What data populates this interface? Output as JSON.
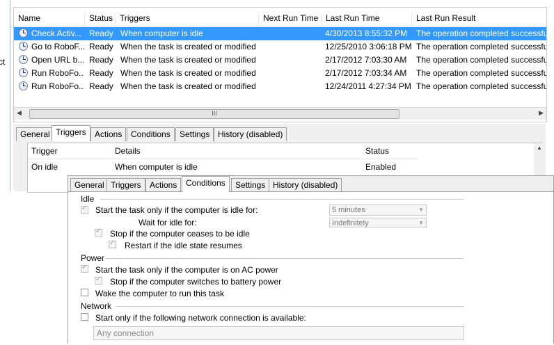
{
  "left_fragment": {
    "text": "ct"
  },
  "task_list": {
    "columns": [
      "Name",
      "Status",
      "Triggers",
      "Next Run Time",
      "Last Run Time",
      "Last Run Result"
    ],
    "rows": [
      {
        "name": "Check Activ...",
        "status": "Ready",
        "triggers": "When computer is idle",
        "next_run": "",
        "last_run": "4/30/2013 8:55:32 PM",
        "result": "The operation completed successfu",
        "selected": true
      },
      {
        "name": "Go to RoboF...",
        "status": "Ready",
        "triggers": "When the task is created or modified",
        "next_run": "",
        "last_run": "12/25/2010 3:06:18 PM",
        "result": "The operation completed successfu",
        "selected": false
      },
      {
        "name": "Open URL b...",
        "status": "Ready",
        "triggers": "When the task is created or modified",
        "next_run": "",
        "last_run": "2/17/2012 7:03:30 AM",
        "result": "The operation completed successfu",
        "selected": false
      },
      {
        "name": "Run RoboFo...",
        "status": "Ready",
        "triggers": "When the task is created or modified",
        "next_run": "",
        "last_run": "2/17/2012 7:03:34 AM",
        "result": "The operation completed successfu",
        "selected": false
      },
      {
        "name": "Run RoboFo...",
        "status": "Ready",
        "triggers": "When the task is created or modified",
        "next_run": "",
        "last_run": "12/24/2011 4:27:34 PM",
        "result": "The operation completed successfu",
        "selected": false
      }
    ],
    "scroll_thumb_label": "III"
  },
  "lower_tabs": [
    "General",
    "Triggers",
    "Actions",
    "Conditions",
    "Settings",
    "History (disabled)"
  ],
  "lower_active_tab": "Triggers",
  "triggers_table": {
    "columns": [
      "Trigger",
      "Details",
      "Status"
    ],
    "rows": [
      {
        "trigger": "On idle",
        "details": "When computer is idle",
        "status": "Enabled"
      }
    ]
  },
  "dialog": {
    "tabs": [
      "General",
      "Triggers",
      "Actions",
      "Conditions",
      "Settings",
      "History (disabled)"
    ],
    "active_tab": "Conditions",
    "idle": {
      "heading": "Idle",
      "start_if_idle_label": "Start the task only if the computer is idle for:",
      "idle_for_value": "5 minutes",
      "wait_label": "Wait for idle for:",
      "wait_value": "Indefinitely",
      "stop_label": "Stop if the computer ceases to be idle",
      "restart_label": "Restart if the idle state resumes"
    },
    "power": {
      "heading": "Power",
      "ac_label": "Start the task only if the computer is on AC power",
      "battery_label": "Stop if the computer switches to battery power",
      "wake_label": "Wake the computer to run this task"
    },
    "network": {
      "heading": "Network",
      "network_label": "Start only if the following network connection is available:",
      "connection_value": "Any connection"
    }
  }
}
